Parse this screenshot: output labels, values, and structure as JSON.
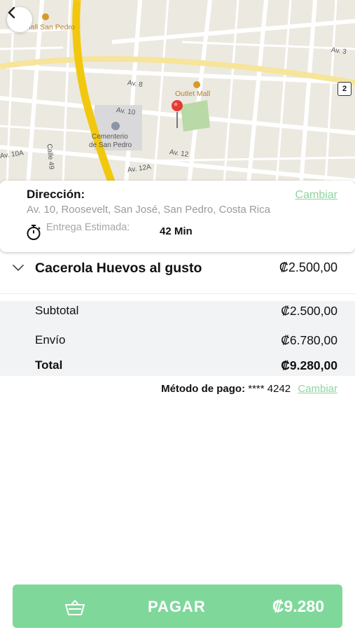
{
  "map": {
    "labels": {
      "mall_san_pedro": "Mall San Pedro",
      "outlet_mall": "Outlet Mall",
      "av8": "Av. 8",
      "av10": "Av. 10",
      "av10a": "Av. 10A",
      "av12": "Av. 12",
      "av12a": "Av. 12A",
      "av3": "Av. 3",
      "calle49": "Calle 49",
      "cementerio1": "Cementerio",
      "cementerio2": "de San Pedro",
      "route_number": "2"
    },
    "colors": {
      "highway": "#f2c80f",
      "marker": "#e53935",
      "park": "#b9d9a6"
    }
  },
  "address": {
    "title": "Dirección:",
    "change": "Cambiar",
    "line": "Av. 10, Roosevelt, San José, San Pedro, Costa Rica",
    "eta_label": "Entrega Estimada:",
    "eta_value": "42 Min"
  },
  "item": {
    "name": "Cacerola Huevos al gusto",
    "price": "₡2.500,00"
  },
  "summary": {
    "subtotal_label": "Subtotal",
    "subtotal_value": "₡2.500,00",
    "shipping_label": "Envío",
    "shipping_value": "₡6.780,00",
    "total_label": "Total",
    "total_value": "₡9.280,00"
  },
  "payment": {
    "label": "Método de pago:",
    "card": "**** 4242",
    "change": "Cambiar"
  },
  "pay_button": {
    "label": "PAGAR",
    "amount": "₡9.280"
  },
  "colors": {
    "accent": "#7fd89a",
    "link": "#8fd49f",
    "summary_bg": "#f1f3f5"
  },
  "icons": {
    "back": "chevron-left-icon",
    "eta": "stopwatch-icon",
    "expand": "chevron-down-icon",
    "cart": "basket-icon"
  }
}
